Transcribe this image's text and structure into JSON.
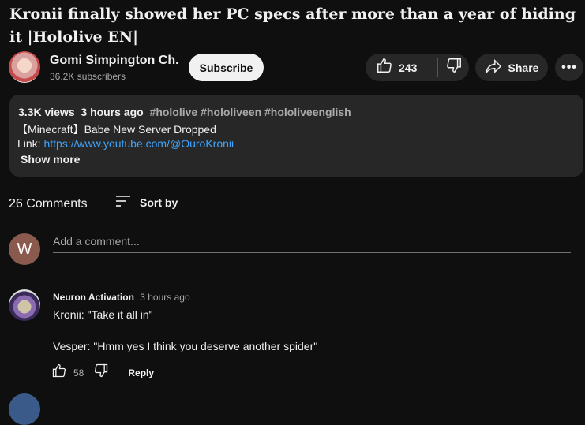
{
  "video": {
    "title": "Kronii finally showed her PC specs after more than a year of hiding it |Hololive EN|"
  },
  "channel": {
    "name": "Gomi Simpington Ch.",
    "subscribers": "36.2K subscribers",
    "subscribe_label": "Subscribe"
  },
  "actions": {
    "likes": "243",
    "share_label": "Share",
    "more_label": "•••"
  },
  "description": {
    "views": "3.3K views",
    "time": "3 hours ago",
    "tags": "#hololive #hololiveen #hololiveenglish",
    "line2": "【Minecraft】Babe New Server Dropped",
    "link_prefix": "Link: ",
    "link_url": "https://www.youtube.com/@OuroKronii",
    "show_more": "Show more"
  },
  "comments": {
    "count_label": "26 Comments",
    "sort_label": "Sort by",
    "user_initial": "W",
    "add_placeholder": "Add a comment...",
    "items": [
      {
        "author": "Neuron Activation",
        "time": "3 hours ago",
        "text_line1": "Kronii: \"Take it all in\"",
        "text_line2": "Vesper: \"Hmm yes I think you deserve another spider\"",
        "likes": "58",
        "reply_label": "Reply"
      }
    ]
  },
  "colors": {
    "background": "#0f0f0f",
    "surface": "#272727",
    "link": "#3ea6ff",
    "muted_text": "#aaaaaa"
  },
  "icons": [
    "thumbs-up-icon",
    "thumbs-down-icon",
    "share-arrow-icon",
    "more-dots-icon",
    "sort-icon"
  ]
}
